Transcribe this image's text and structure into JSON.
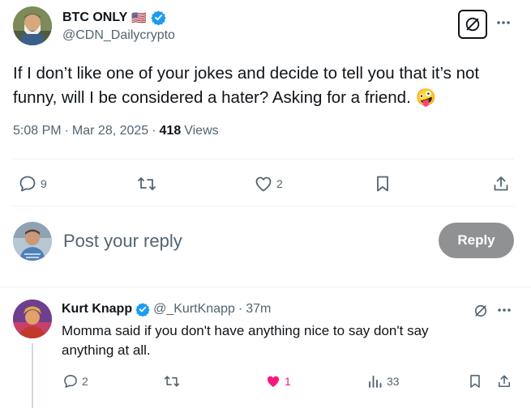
{
  "post": {
    "display_name": "BTC ONLY",
    "flag": "🇺🇸",
    "handle": "@CDN_Dailycrypto",
    "text": "If I don’t like one of your jokes and decide to tell you that it’s not funny, will I be considered a hater? Asking for a friend. 🤪",
    "time": "5:08 PM",
    "date": "Mar 28, 2025",
    "views_count": "418",
    "views_label": "Views",
    "replies": "9",
    "likes": "2"
  },
  "composer": {
    "placeholder": "Post your reply",
    "button_label": "Reply"
  },
  "reply": {
    "display_name": "Kurt Knapp",
    "handle": "@_KurtKnapp",
    "separator": "·",
    "time": "37m",
    "text": "Momma said if you don't have anything nice to say don't say anything at all.",
    "replies": "2",
    "likes": "1",
    "views": "33"
  },
  "colors": {
    "verified": "#1d9bf0",
    "like_active": "#f91880",
    "text_secondary": "#536471",
    "reply_button": "#8f9193"
  }
}
